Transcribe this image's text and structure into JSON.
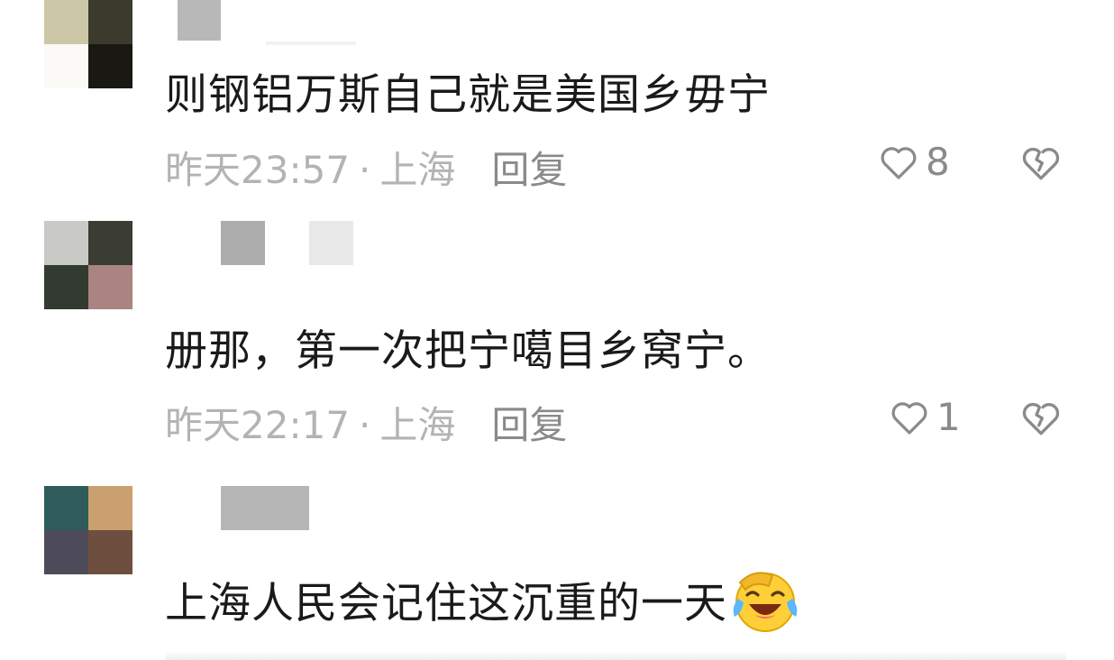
{
  "comments": [
    {
      "text": "则钢铝万斯自己就是美国乡毋宁",
      "time": "昨天23:57",
      "location": "上海",
      "reply_label": "回复",
      "likes": "8",
      "avatar_colors": [
        "#cbc7a7",
        "#3c3a2d",
        "#fbfaf6",
        "#1a1812"
      ],
      "name_block_colors": [
        "#b8b8b8",
        "#f2f2f2"
      ]
    },
    {
      "text": "册那，第一次把宁噶目乡窝宁。",
      "time": "昨天22:17",
      "location": "上海",
      "reply_label": "回复",
      "likes": "1",
      "avatar_colors": [
        "#c9c9c6",
        "#3b3c33",
        "#323a31",
        "#a98481"
      ],
      "name_block_colors": [
        "#adadad",
        "#e8e8e8"
      ]
    },
    {
      "text": "上海人民会记住这沉重的一天",
      "emoji": "laughing-crying-emoji",
      "avatar_colors": [
        "#2f5c5a",
        "#c9a06e",
        "#4d4b5a",
        "#6e4f3f"
      ],
      "name_block_colors": [
        "#b5b5b5"
      ]
    }
  ],
  "icons": {
    "like": "heart-outline-icon",
    "dislike": "broken-heart-icon"
  },
  "colors": {
    "meta_text": "#b3b3b3",
    "reply_text": "#8a8a8a",
    "comment_text": "#1a1a1a"
  }
}
